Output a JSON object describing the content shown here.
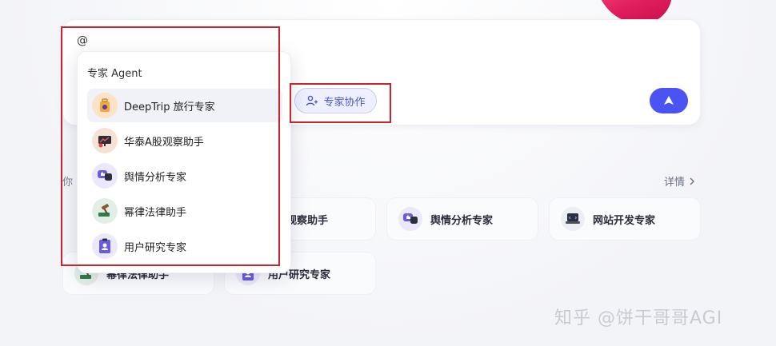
{
  "composer": {
    "input_value": "@",
    "collab_button_label": "专家协作"
  },
  "dropdown": {
    "header": "专家 Agent",
    "items": [
      {
        "label": "DeepTrip 旅行专家",
        "icon": "suitcase-icon"
      },
      {
        "label": "华泰A股观察助手",
        "icon": "stock-monitor-icon"
      },
      {
        "label": "舆情分析专家",
        "icon": "thumbs-chat-icon"
      },
      {
        "label": "幂律法律助手",
        "icon": "gavel-icon"
      },
      {
        "label": "用户研究专家",
        "icon": "clipboard-user-icon"
      }
    ]
  },
  "section": {
    "label_partial": "你",
    "details_label": "详情"
  },
  "cards": [
    {
      "label": "A股观察助手",
      "icon": "stock-monitor-icon"
    },
    {
      "label": "舆情分析专家",
      "icon": "thumbs-chat-icon"
    },
    {
      "label": "网站开发专家",
      "icon": "laptop-code-icon"
    },
    {
      "label": "幂律法律助手",
      "icon": "gavel-icon"
    },
    {
      "label": "用户研究专家",
      "icon": "clipboard-user-icon"
    }
  ],
  "watermark": "知乎 @饼干哥哥AGI",
  "colors": {
    "accent": "#4b53f2",
    "highlight": "#c8262c",
    "collab_bg": "#eef0ff"
  }
}
